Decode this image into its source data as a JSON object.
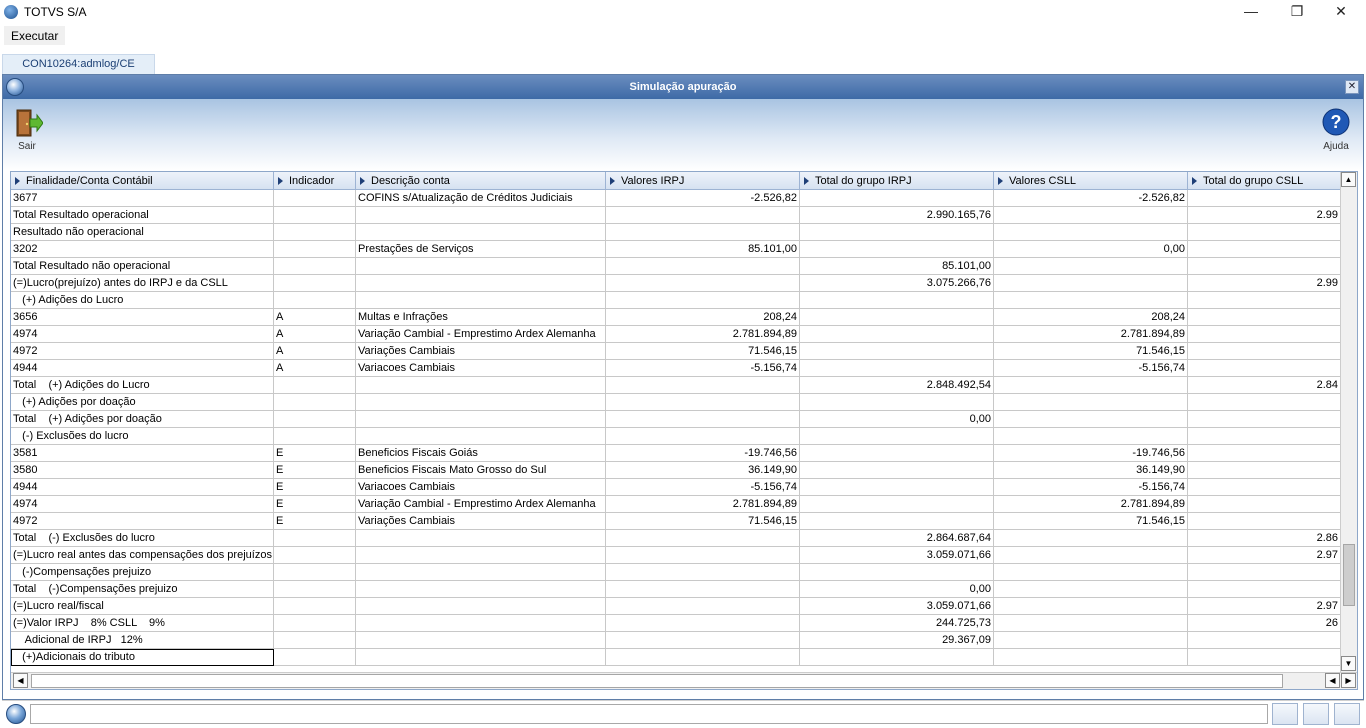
{
  "app": {
    "title": "TOTVS S/A"
  },
  "menu": {
    "executar": "Executar"
  },
  "tab": {
    "label": "CON10264:admlog/CE"
  },
  "window": {
    "title": "Simulação apuração"
  },
  "toolbar": {
    "sair": "Sair",
    "ajuda": "Ajuda"
  },
  "columns": [
    "Finalidade/Conta Contábil",
    "Indicador",
    "Descrição conta",
    "Valores IRPJ",
    "Total do grupo IRPJ",
    "Valores CSLL",
    "Total do grupo CSLL"
  ],
  "rows": [
    [
      "3677",
      "",
      "COFINS s/Atualização de Créditos Judiciais",
      "-2.526,82",
      "",
      "-2.526,82",
      ""
    ],
    [
      "Total Resultado operacional",
      "",
      "",
      "",
      "2.990.165,76",
      "",
      "2.99"
    ],
    [
      "Resultado não operacional",
      "",
      "",
      "",
      "",
      "",
      ""
    ],
    [
      "3202",
      "",
      "Prestações de Serviços",
      "85.101,00",
      "",
      "0,00",
      ""
    ],
    [
      "Total Resultado não operacional",
      "",
      "",
      "",
      "85.101,00",
      "",
      ""
    ],
    [
      "(=)Lucro(prejuízo) antes do IRPJ e da CSLL",
      "",
      "",
      "",
      "3.075.266,76",
      "",
      "2.99"
    ],
    [
      "   (+) Adições do Lucro",
      "",
      "",
      "",
      "",
      "",
      ""
    ],
    [
      "3656",
      "A",
      "Multas e Infrações",
      "208,24",
      "",
      "208,24",
      ""
    ],
    [
      "4974",
      "A",
      "Variação Cambial - Emprestimo Ardex Alemanha",
      "2.781.894,89",
      "",
      "2.781.894,89",
      ""
    ],
    [
      "4972",
      "A",
      "Variações Cambiais",
      "71.546,15",
      "",
      "71.546,15",
      ""
    ],
    [
      "4944",
      "A",
      "Variacoes Cambiais",
      "-5.156,74",
      "",
      "-5.156,74",
      ""
    ],
    [
      "Total    (+) Adições do Lucro",
      "",
      "",
      "",
      "2.848.492,54",
      "",
      "2.84"
    ],
    [
      "   (+) Adições por doação",
      "",
      "",
      "",
      "",
      "",
      ""
    ],
    [
      "Total    (+) Adições por doação",
      "",
      "",
      "",
      "0,00",
      "",
      ""
    ],
    [
      "   (-) Exclusões do lucro",
      "",
      "",
      "",
      "",
      "",
      ""
    ],
    [
      "3581",
      "E",
      "Beneficios Fiscais Goiás",
      "-19.746,56",
      "",
      "-19.746,56",
      ""
    ],
    [
      "3580",
      "E",
      "Beneficios Fiscais Mato Grosso do Sul",
      "36.149,90",
      "",
      "36.149,90",
      ""
    ],
    [
      "4944",
      "E",
      "Variacoes Cambiais",
      "-5.156,74",
      "",
      "-5.156,74",
      ""
    ],
    [
      "4974",
      "E",
      "Variação Cambial - Emprestimo Ardex Alemanha",
      "2.781.894,89",
      "",
      "2.781.894,89",
      ""
    ],
    [
      "4972",
      "E",
      "Variações Cambiais",
      "71.546,15",
      "",
      "71.546,15",
      ""
    ],
    [
      "Total    (-) Exclusões do lucro",
      "",
      "",
      "",
      "2.864.687,64",
      "",
      "2.86"
    ],
    [
      "(=)Lucro real antes das compensações dos prejuízos",
      "",
      "",
      "",
      "3.059.071,66",
      "",
      "2.97"
    ],
    [
      "   (-)Compensações prejuizo",
      "",
      "",
      "",
      "",
      "",
      ""
    ],
    [
      "Total    (-)Compensações prejuizo",
      "",
      "",
      "",
      "0,00",
      "",
      ""
    ],
    [
      "(=)Lucro real/fiscal",
      "",
      "",
      "",
      "3.059.071,66",
      "",
      "2.97"
    ],
    [
      "(=)Valor IRPJ    8% CSLL    9%",
      "",
      "",
      "",
      "244.725,73",
      "",
      "26"
    ],
    [
      "    Adicional de IRPJ   12%",
      "",
      "",
      "",
      "29.367,09",
      "",
      ""
    ],
    [
      "   (+)Adicionais do tributo",
      "",
      "",
      "",
      "",
      "",
      ""
    ]
  ]
}
